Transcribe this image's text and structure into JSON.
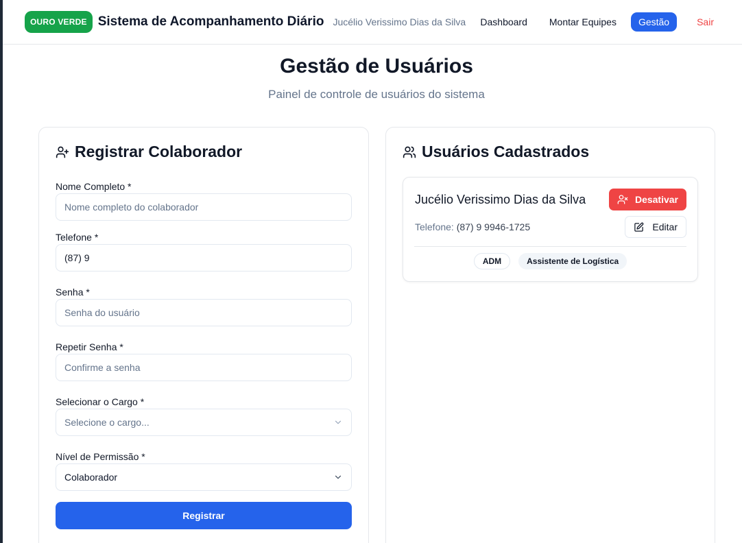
{
  "header": {
    "brand": "OURO VERDE",
    "title": "Sistema de Acompanhamento Diário",
    "user_name": "Jucélio Verissimo Dias da Silva",
    "nav": {
      "dashboard": "Dashboard",
      "montar_equipes": "Montar Equipes",
      "gestao": "Gestão",
      "sair": "Sair"
    }
  },
  "page": {
    "title": "Gestão de Usuários",
    "subtitle": "Painel de controle de usuários do sistema"
  },
  "register_form": {
    "title": "Registrar Colaborador",
    "nome_label": "Nome Completo *",
    "nome_placeholder": "Nome completo do colaborador",
    "nome_value": "",
    "telefone_label": "Telefone *",
    "telefone_value": "(87) 9",
    "senha_label": "Senha *",
    "senha_placeholder": "Senha do usuário",
    "repetir_senha_label": "Repetir Senha *",
    "repetir_senha_placeholder": "Confirme a senha",
    "cargo_label": "Selecionar o Cargo *",
    "cargo_selected": "Selecione o cargo...",
    "permissao_label": "Nível de Permissão *",
    "permissao_selected": "Colaborador",
    "submit_label": "Registrar"
  },
  "users_panel": {
    "title": "Usuários Cadastrados",
    "users": [
      {
        "name": "Jucélio Verissimo Dias da Silva",
        "phone_label": "Telefone:",
        "phone": "(87) 9 9946-1725",
        "deactivate_label": "Desativar",
        "edit_label": "Editar",
        "badges": [
          "ADM",
          "Assistente de Logística"
        ]
      }
    ]
  },
  "colors": {
    "brand_green": "#16a34a",
    "primary_blue": "#2563eb",
    "danger_red": "#ef4444"
  },
  "icons": [
    "user-plus-icon",
    "users-icon",
    "user-x-icon",
    "edit-icon",
    "chevron-down-icon"
  ]
}
